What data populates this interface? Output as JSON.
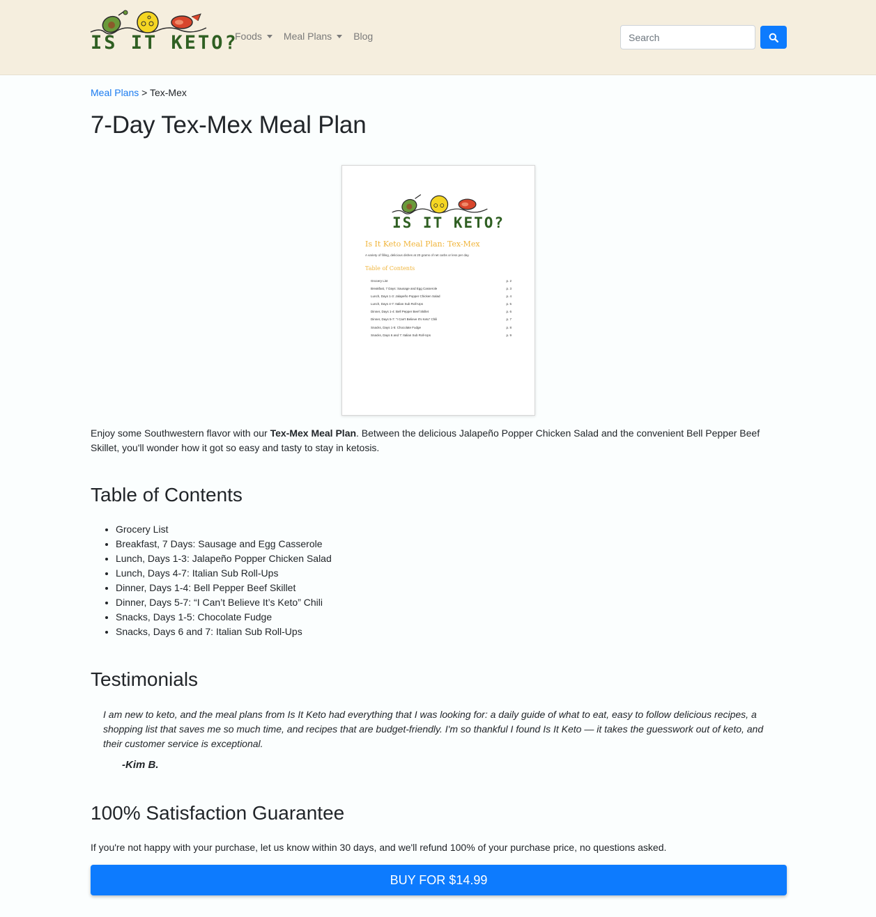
{
  "brand": {
    "logo_text": "IS IT KETO?",
    "colors": {
      "logo_green": "#2f5f22",
      "avocado": "#6a9a3a",
      "cheese": "#f5d623",
      "steak": "#d8462c",
      "accent_blue": "#0d7bfe"
    }
  },
  "nav": {
    "foods": "Foods",
    "meal_plans": "Meal Plans",
    "blog": "Blog"
  },
  "search": {
    "placeholder": "Search",
    "icon": "search-icon"
  },
  "breadcrumb": {
    "parent": "Meal Plans",
    "separator": ">",
    "current": "Tex-Mex"
  },
  "page_title": "7-Day Tex-Mex Meal Plan",
  "cover": {
    "logo_text": "IS IT KETO?",
    "title": "Is It Keto Meal Plan: Tex-Mex",
    "subtitle": "A variety of filling, delicious dishes at 20 grams of net carbs or less per day.",
    "toc_heading": "Table of Contents",
    "toc": [
      {
        "label": "Grocery List",
        "page": "p. 2"
      },
      {
        "label": "Breakfast, 7 Days: Sausage and Egg Casserole",
        "page": "p. 3"
      },
      {
        "label": "Lunch, Days 1-3: Jalapeño Popper Chicken Salad",
        "page": "p. 4"
      },
      {
        "label": "Lunch, Days 4-7: Italian Sub Roll-Ups",
        "page": "p. 5"
      },
      {
        "label": "Dinner, Days 1-4: Bell Pepper Beef Skillet",
        "page": "p. 6"
      },
      {
        "label": "Dinner, Days 5-7: “I Can't Believe It's Keto” Chili",
        "page": "p. 7"
      },
      {
        "label": "Snacks, Days 1-5: Chocolate Fudge",
        "page": "p. 8"
      },
      {
        "label": "Snacks, Days 6 and 7: Italian Sub Roll-Ups",
        "page": "p. 9"
      }
    ]
  },
  "intro": {
    "before": "Enjoy some Southwestern flavor with our ",
    "bold": "Tex-Mex Meal Plan",
    "after": ". Between the delicious Jalapeño Popper Chicken Salad and the convenient Bell Pepper Beef Skillet, you'll wonder how it got so easy and tasty to stay in ketosis."
  },
  "toc": {
    "heading": "Table of Contents",
    "items": [
      "Grocery List",
      "Breakfast, 7 Days: Sausage and Egg Casserole",
      "Lunch, Days 1-3: Jalapeño Popper Chicken Salad",
      "Lunch, Days 4-7: Italian Sub Roll-Ups",
      "Dinner, Days 1-4: Bell Pepper Beef Skillet",
      "Dinner, Days 5-7: “I Can’t Believe It’s Keto” Chili",
      "Snacks, Days 1-5: Chocolate Fudge",
      "Snacks, Days 6 and 7: Italian Sub Roll-Ups"
    ]
  },
  "testimonials": {
    "heading": "Testimonials",
    "quote": "I am new to keto, and the meal plans from Is It Keto had everything that I was looking for: a daily guide of what to eat, easy to follow delicious recipes, a shopping list that saves me so much time, and recipes that are budget-friendly. I'm so thankful I found Is It Keto — it takes the guesswork out of keto, and their customer service is exceptional.",
    "author": "-Kim B."
  },
  "guarantee": {
    "heading": "100% Satisfaction Guarantee",
    "text": "If you're not happy with your purchase, let us know within 30 days, and we'll refund 100% of your purchase price, no questions asked."
  },
  "buy_button": "BUY FOR $14.99"
}
